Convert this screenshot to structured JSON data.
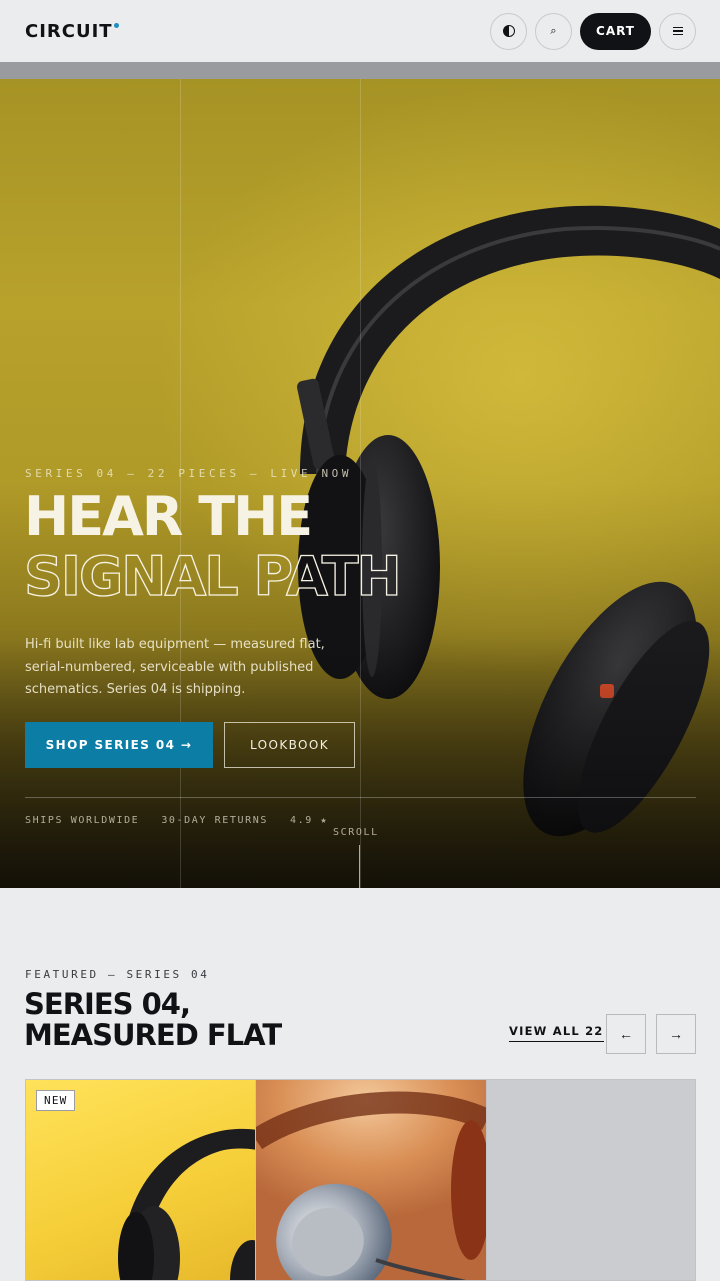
{
  "header": {
    "logo": "CIRCUIT",
    "theme_icon": "half-moon-icon",
    "search_icon": "search-icon",
    "search_glyph": "⌕",
    "cart_label": "CART",
    "menu_icon": "hamburger-icon"
  },
  "hero": {
    "eyebrow": "SERIES 04 — 22 PIECES — LIVE NOW",
    "headline_line1": "HEAR THE",
    "headline_line2": "SIGNAL PATH",
    "copy": "Hi-fi built like lab equipment — measured flat, serial-numbered, serviceable with published schematics. Series 04 is shipping.",
    "primary_cta": "SHOP SERIES 04 →",
    "secondary_cta": "LOOKBOOK",
    "trust": [
      "SHIPS WORLDWIDE",
      "30-DAY RETURNS",
      "4.9 ★"
    ],
    "scroll_label": "SCROLL",
    "colors": {
      "accent": "#0c7ea5",
      "hero_bg": "#b8a22c"
    }
  },
  "featured": {
    "eyebrow": "FEATURED — SERIES 04",
    "title_line1": "SERIES 04,",
    "title_line2": "MEASURED FLAT",
    "view_all": "VIEW ALL 22",
    "prev_glyph": "←",
    "next_glyph": "→",
    "cards": [
      {
        "badge": "NEW",
        "image": "yellow headphones"
      },
      {
        "image": "copper earbud"
      },
      {
        "image": "placeholder"
      }
    ]
  }
}
